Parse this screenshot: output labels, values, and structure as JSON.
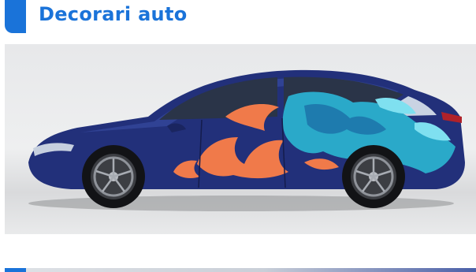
{
  "section": {
    "title": "Decorari auto"
  },
  "hero_image": {
    "icon": "car-wrap-photo",
    "alt": ""
  },
  "colors": {
    "accent": "#1a73d9",
    "car_body": "#22307a",
    "wrap_orange": "#f07a4a",
    "wrap_teal": "#2aa9c9"
  }
}
